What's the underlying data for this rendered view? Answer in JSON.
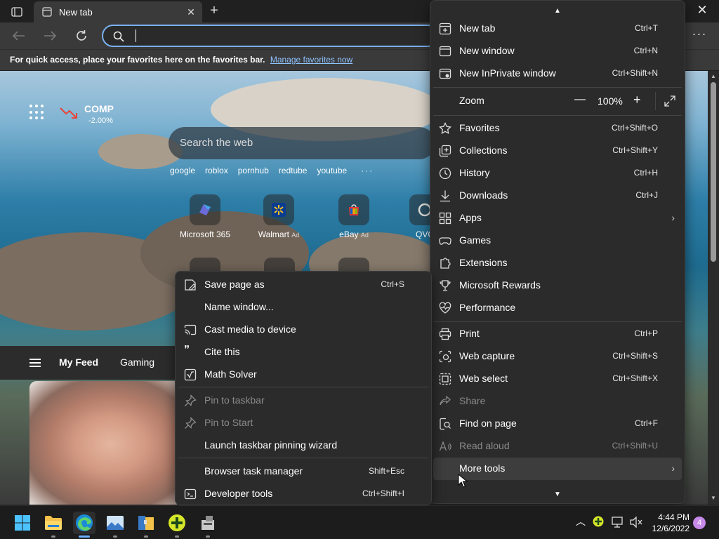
{
  "browser": {
    "tab_title": "New tab",
    "tab_close": "✕",
    "new_tab_symbol": "+",
    "window_close": "✕",
    "address_value": "",
    "more_symbol": "···"
  },
  "favorites_bar": {
    "text": "For quick access, place your favorites here on the favorites bar.",
    "link": "Manage favorites now"
  },
  "newtab": {
    "stock": {
      "symbol": "COMP",
      "change": "-2.00%"
    },
    "search_placeholder": "Search the web",
    "quick_links": [
      "google",
      "roblox",
      "pornhub",
      "redtube",
      "youtube"
    ],
    "quick_links_more": "···",
    "tiles": [
      {
        "label": "Microsoft 365",
        "ad": ""
      },
      {
        "label": "Walmart",
        "ad": "Ad"
      },
      {
        "label": "eBay",
        "ad": "Ad"
      },
      {
        "label": "QVC",
        "ad": ""
      }
    ],
    "feed_tabs": [
      "My Feed",
      "Gaming"
    ]
  },
  "settings_menu": {
    "new_tab": {
      "label": "New tab",
      "shortcut": "Ctrl+T"
    },
    "new_window": {
      "label": "New window",
      "shortcut": "Ctrl+N"
    },
    "new_inprivate": {
      "label": "New InPrivate window",
      "shortcut": "Ctrl+Shift+N"
    },
    "zoom": {
      "label": "Zoom",
      "value": "100%",
      "minus": "—",
      "plus": "+"
    },
    "favorites": {
      "label": "Favorites",
      "shortcut": "Ctrl+Shift+O"
    },
    "collections": {
      "label": "Collections",
      "shortcut": "Ctrl+Shift+Y"
    },
    "history": {
      "label": "History",
      "shortcut": "Ctrl+H"
    },
    "downloads": {
      "label": "Downloads",
      "shortcut": "Ctrl+J"
    },
    "apps": {
      "label": "Apps"
    },
    "games": {
      "label": "Games"
    },
    "extensions": {
      "label": "Extensions"
    },
    "rewards": {
      "label": "Microsoft Rewards"
    },
    "performance": {
      "label": "Performance"
    },
    "print": {
      "label": "Print",
      "shortcut": "Ctrl+P"
    },
    "web_capture": {
      "label": "Web capture",
      "shortcut": "Ctrl+Shift+S"
    },
    "web_select": {
      "label": "Web select",
      "shortcut": "Ctrl+Shift+X"
    },
    "share": {
      "label": "Share"
    },
    "find_on_page": {
      "label": "Find on page",
      "shortcut": "Ctrl+F"
    },
    "read_aloud": {
      "label": "Read aloud",
      "shortcut": "Ctrl+Shift+U"
    },
    "more_tools": {
      "label": "More tools"
    }
  },
  "more_tools_menu": {
    "save_page_as": {
      "label": "Save page as",
      "shortcut": "Ctrl+S"
    },
    "name_window": {
      "label": "Name window..."
    },
    "cast_media": {
      "label": "Cast media to device"
    },
    "cite_this": {
      "label": "Cite this"
    },
    "math_solver": {
      "label": "Math Solver"
    },
    "pin_to_taskbar": {
      "label": "Pin to taskbar"
    },
    "pin_to_start": {
      "label": "Pin to Start"
    },
    "launch_pinning_wizard": {
      "label": "Launch taskbar pinning wizard"
    },
    "task_manager": {
      "label": "Browser task manager",
      "shortcut": "Shift+Esc"
    },
    "developer_tools": {
      "label": "Developer tools",
      "shortcut": "Ctrl+Shift+I"
    }
  },
  "taskbar": {
    "time": "4:44 PM",
    "date": "12/6/2022",
    "notification_count": "4"
  },
  "colors": {
    "accent": "#7ab1f0",
    "link": "#8fc3ff",
    "menu_bg": "#2b2b2b",
    "stock_down": "#e8443a"
  }
}
